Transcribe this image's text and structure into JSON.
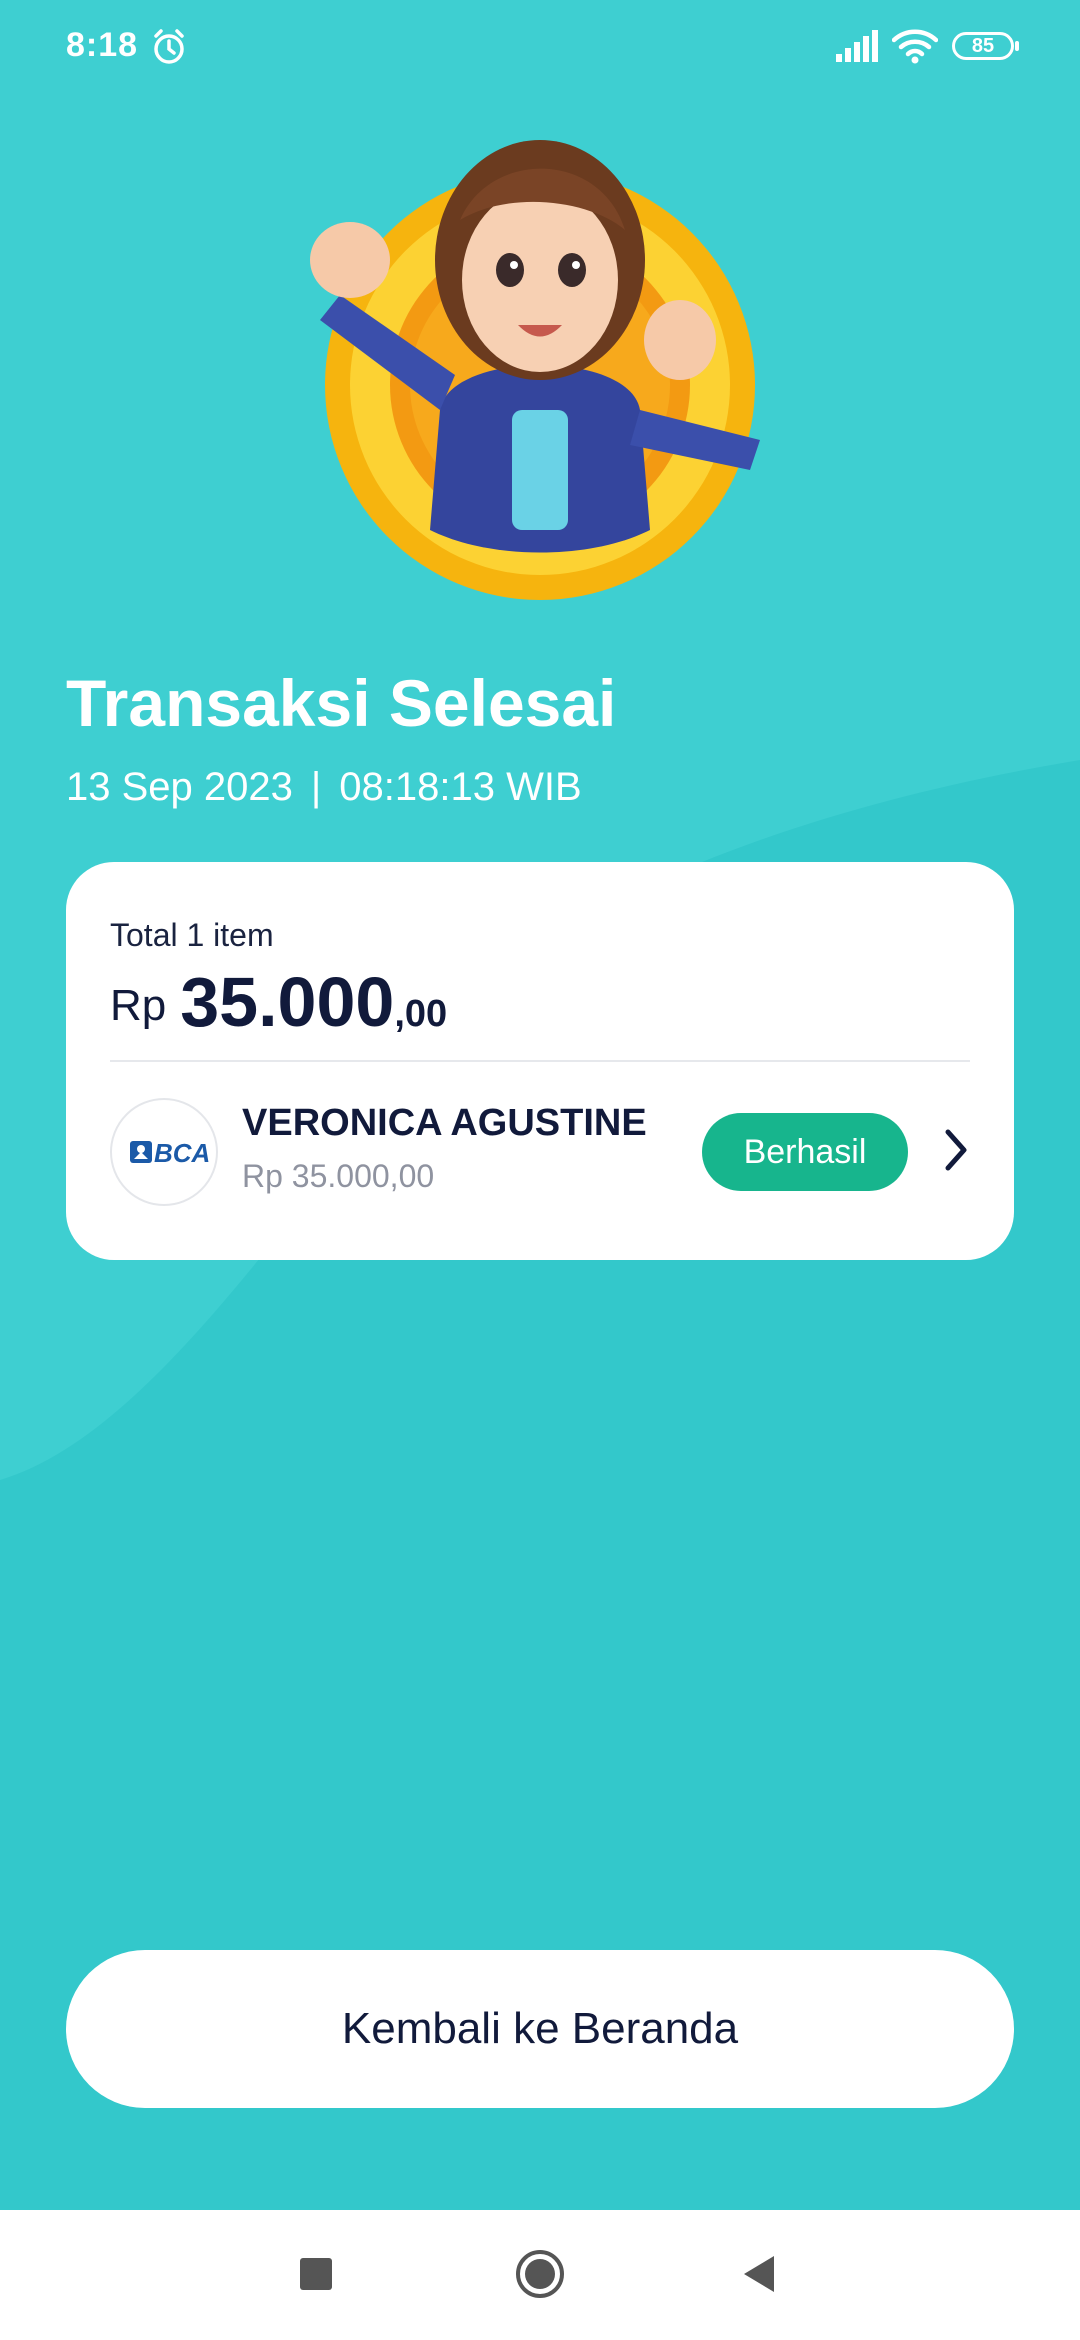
{
  "status_bar": {
    "time": "8:18",
    "battery": "85"
  },
  "result": {
    "title": "Transaksi Selesai",
    "date": "13 Sep 2023",
    "separator": "|",
    "time": "08:18:13 WIB"
  },
  "summary": {
    "total_label": "Total 1 item",
    "currency": "Rp",
    "amount_main": "35.000",
    "amount_decimal": ",00"
  },
  "transaction": {
    "bank_name": "BCA",
    "recipient": "VERONICA AGUSTINE",
    "amount": "Rp 35.000,00",
    "status": "Berhasil"
  },
  "actions": {
    "home_label": "Kembali ke Beranda"
  },
  "colors": {
    "background": "#3dcdcf",
    "status_success": "#17b58d",
    "text_dark": "#111a3b",
    "bank_blue": "#1b5aa8"
  },
  "icons": {
    "alarm": "alarm-icon",
    "signal": "signal-icon",
    "wifi": "wifi-icon",
    "chevron": "chevron-right-icon",
    "nav_recent": "square-icon",
    "nav_home": "circle-icon",
    "nav_back": "triangle-back-icon"
  }
}
